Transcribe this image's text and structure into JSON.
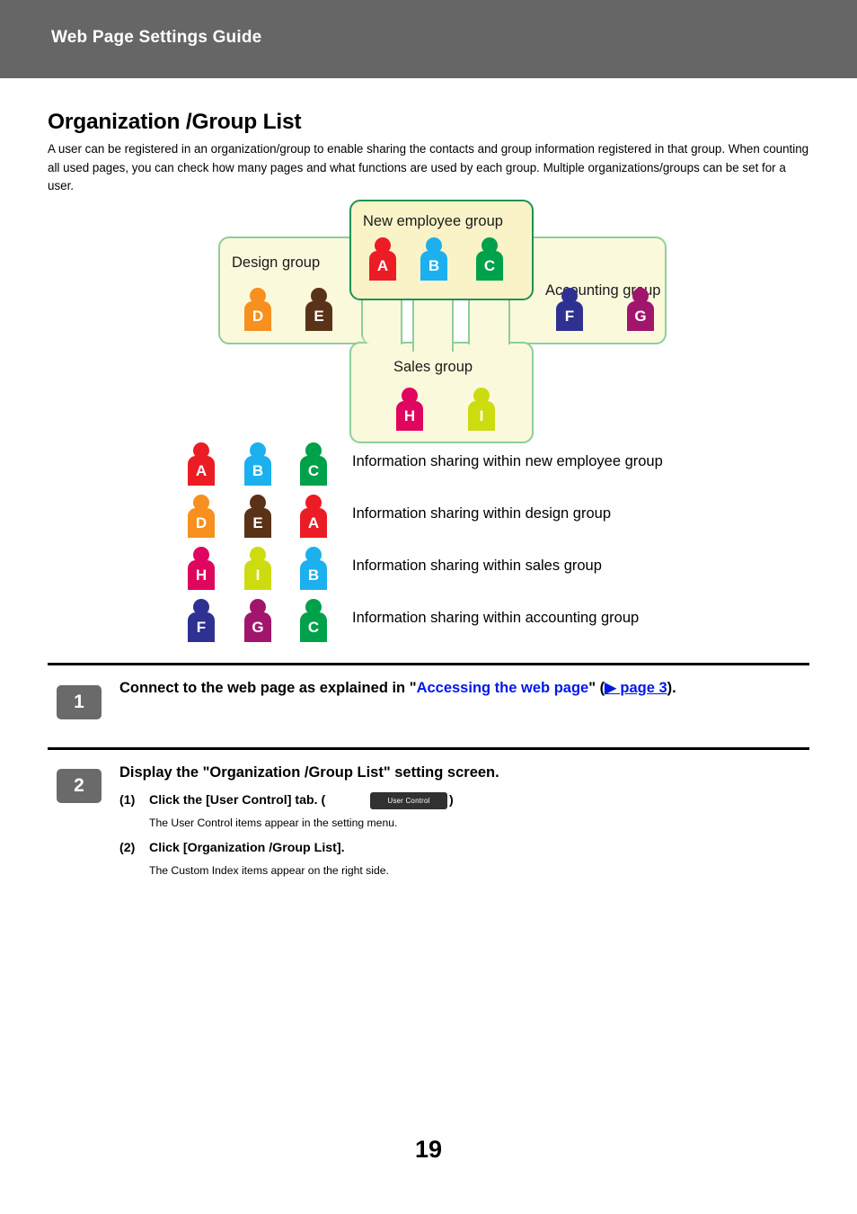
{
  "header": {
    "title": "Web Page Settings Guide",
    "bar_color": "#666666"
  },
  "page": {
    "title": "Organization /Group List",
    "intro": "A user can be registered in an organization/group to enable sharing the contacts and group information registered in that group. When counting all used pages, you can check how many pages and what functions are used by each group. Multiple organizations/groups can be set for a user.",
    "number": "19"
  },
  "diagram": {
    "groups": [
      {
        "id": "design",
        "label": "Design group"
      },
      {
        "id": "newemp",
        "label": "New employee group"
      },
      {
        "id": "accounting",
        "label": "Accounting group"
      },
      {
        "id": "sales",
        "label": "Sales group"
      }
    ],
    "members": {
      "A": {
        "letter": "A",
        "color": "#EC1C24"
      },
      "B": {
        "letter": "B",
        "color": "#1CB0EE"
      },
      "C": {
        "letter": "C",
        "color": "#00A14B"
      },
      "D": {
        "letter": "D",
        "color": "#F7901E"
      },
      "E": {
        "letter": "E",
        "color": "#5A3218"
      },
      "F": {
        "letter": "F",
        "color": "#2E3192"
      },
      "G": {
        "letter": "G",
        "color": "#A1166C"
      },
      "H": {
        "letter": "H",
        "color": "#E0055F"
      },
      "I": {
        "letter": "I",
        "color": "#CCDC10"
      }
    },
    "box_fill": "#FBF9DC",
    "box_border": "#8ECE9A",
    "highlight_border": "#1E9251"
  },
  "legend": {
    "rows": [
      {
        "letters": [
          "A",
          "B",
          "C"
        ],
        "text": "Information sharing within new employee group"
      },
      {
        "letters": [
          "D",
          "E",
          "A"
        ],
        "text": "Information sharing within design group"
      },
      {
        "letters": [
          "H",
          "I",
          "B"
        ],
        "text": "Information sharing within sales group"
      },
      {
        "letters": [
          "F",
          "G",
          "C"
        ],
        "text": "Information sharing within accounting group"
      }
    ]
  },
  "steps": [
    {
      "number": "1",
      "title_parts": [
        {
          "text": "Connect to the web page as explained in \"",
          "style": "plain"
        },
        {
          "text": "Accessing the web page",
          "style": "link"
        },
        {
          "text": "\" (",
          "style": "plain"
        },
        {
          "text": "▶ page 3",
          "style": "link-underline"
        },
        {
          "text": ").",
          "style": "plain"
        }
      ]
    },
    {
      "number": "2",
      "title": "Display the \"Organization /Group List\" setting screen.",
      "substeps": [
        {
          "num": "(1)",
          "text_before": "Click the [User Control] tab. (",
          "chip": "User Control",
          "text_after": ")",
          "desc": "The User Control items appear in the setting menu."
        },
        {
          "num": "(2)",
          "text": "Click [Organization /Group List].",
          "desc": "The Custom Index items appear on the right side."
        }
      ]
    }
  ]
}
